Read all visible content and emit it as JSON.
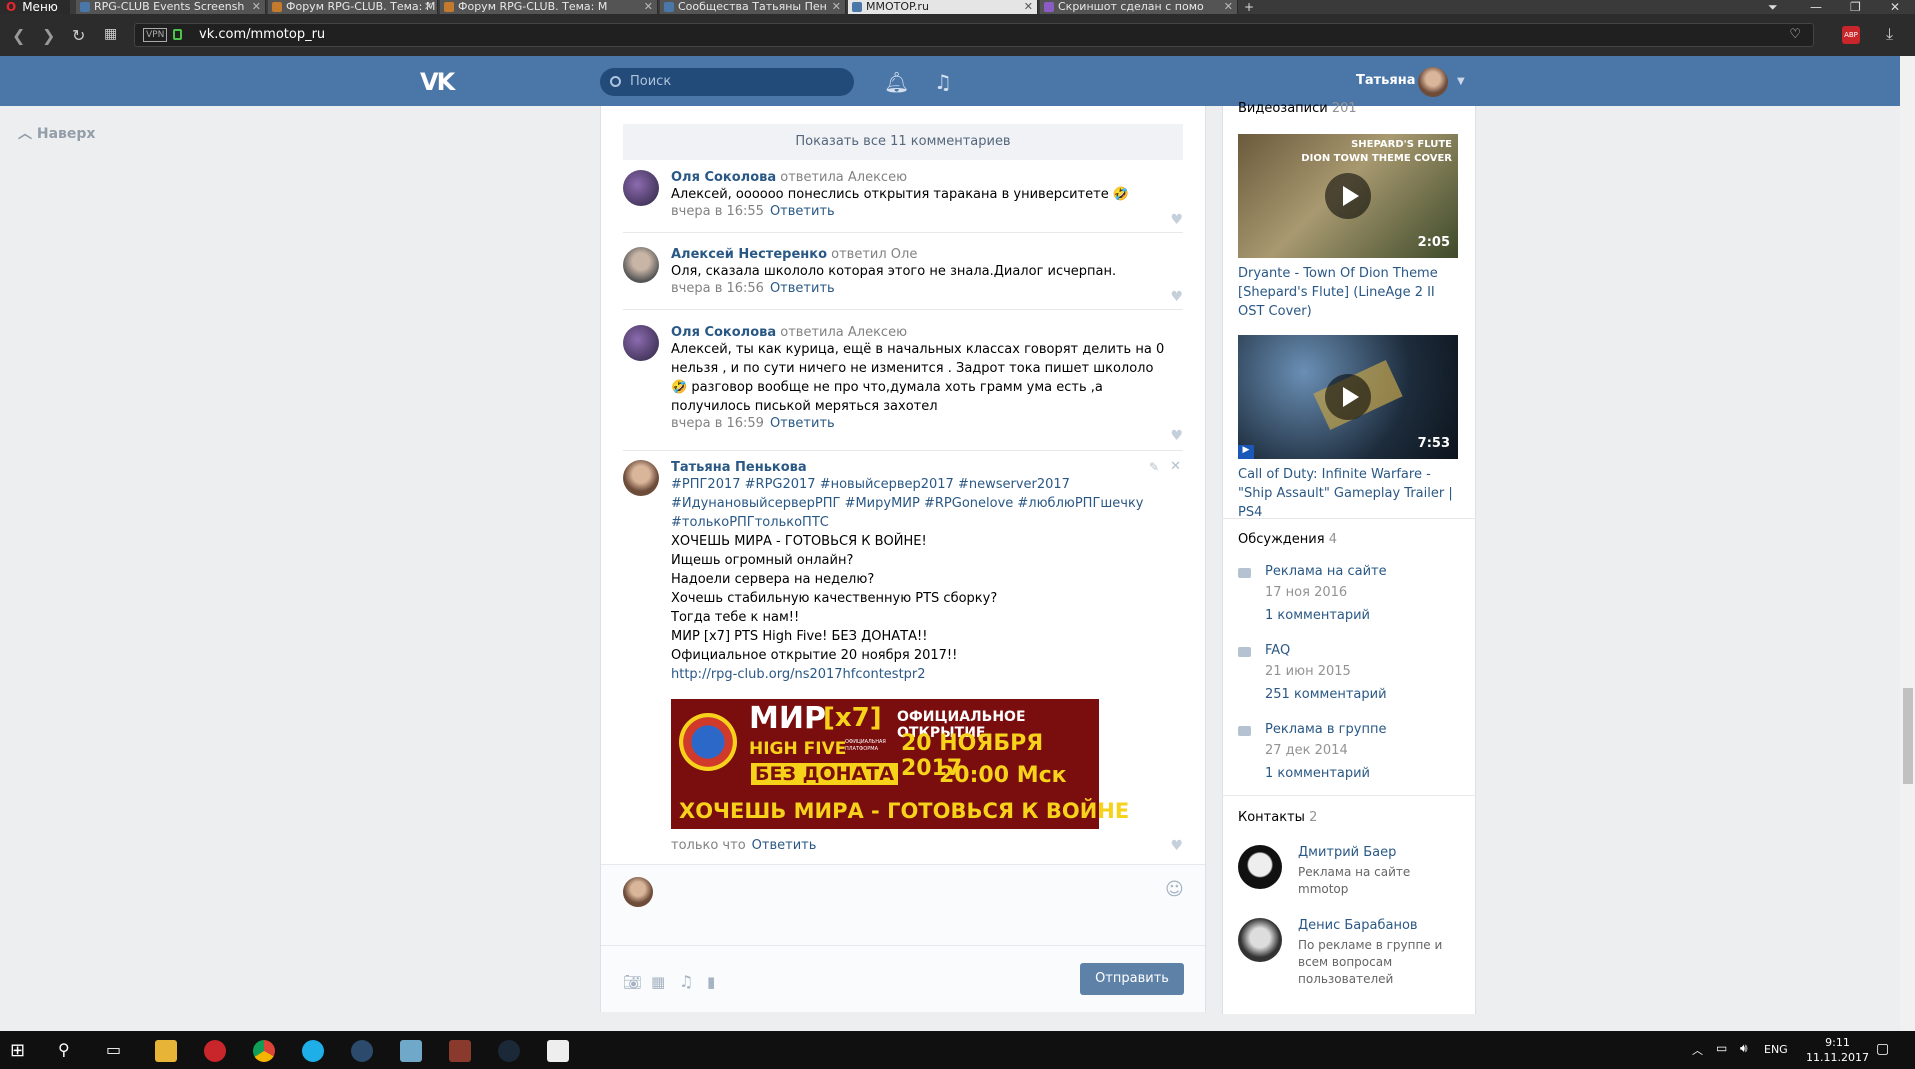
{
  "browser": {
    "menu_label": "Меню",
    "tabs": [
      {
        "title": "RPG-CLUB Events Screensh"
      },
      {
        "title": "Форум RPG-CLUB. Тема: М"
      },
      {
        "title": "Форум RPG-CLUB. Тема: М"
      },
      {
        "title": "Сообщества Татьяны Пен"
      },
      {
        "title": "MMOTOP.ru"
      },
      {
        "title": "Скриншот сделан с помо"
      }
    ],
    "new_tab": "+",
    "url": "vk.com/mmotop_ru",
    "vpn_label": "VPN",
    "abp_label": "ABP"
  },
  "vk_header": {
    "logo": "VK",
    "search_placeholder": "Поиск",
    "user_name": "Татьяна"
  },
  "left_nav": {
    "up_label": "Наверх"
  },
  "wall": {
    "show_all": "Показать все 11 комментариев",
    "comments": [
      {
        "author": "Оля Соколова",
        "reply_to": "ответила Алексею",
        "text": "Алексей, оооооо понеслись открытия таракана в университете 🤣",
        "date": "вчера в 16:55",
        "answer": "Ответить"
      },
      {
        "author": "Алексей Нестеренко",
        "reply_to": "ответил Оле",
        "text": "Оля, сказала школоло которая этого не знала.Диалог исчерпан.",
        "date": "вчера в 16:56",
        "answer": "Ответить"
      },
      {
        "author": "Оля Соколова",
        "reply_to": "ответила Алексею",
        "text": "Алексей, ты как курица, ещё в начальных классах говорят делить на 0 нельзя , и по сути ничего не изменится . Задрот тока пишет школоло🤣 разговор вообще не про что,думала хоть грамм ума есть ,а получилось писькой меряться захотел",
        "date": "вчера в 16:59",
        "answer": "Ответить"
      }
    ],
    "post": {
      "author": "Татьяна Пенькова",
      "hashtags_line1": "#РПГ2017 #RPG2017 #новыйсервер2017 #newserver2017",
      "hashtags_line2": "#ИдунановыйсерверРПГ #МируМИР #RPGonelove #люблюРПГшечку",
      "hashtags_line3": "#толькоРПГтолькоПТС",
      "lines": [
        "ХОЧЕШЬ МИРА - ГОТОВЬСЯ К ВОЙНЕ!",
        "Ищешь огромный онлайн?",
        "Надоели сервера на неделю?",
        "Хочешь стабильную качественную PTS сборку?",
        "Тогда тебе к нам!!",
        "МИР [x7] PTS High Five! БЕЗ ДОНАТА!!",
        "Официальное открытие 20 ноября 2017!!"
      ],
      "link": "http://rpg-club.org/ns2017hfcontestpr2",
      "banner": {
        "mir": "МИР",
        "x7": "[x7]",
        "high_five": "HIGH FIVE",
        "platform": "ОФИЦИАЛЬНАЯ ПЛАТФОРМА",
        "no_donate": "БЕЗ ДОНАТА",
        "official": "ОФИЦИАЛЬНОЕ ОТКРЫТИЕ",
        "date": "20 НОЯБРЯ 2017",
        "time": "20:00 Мск",
        "slogan": "ХОЧЕШЬ МИРА - ГОТОВЬСЯ К ВОЙНЕ"
      },
      "date": "только что",
      "answer": "Ответить"
    },
    "send_label": "Отправить"
  },
  "sidebar": {
    "videos": {
      "title": "Видеозаписи",
      "count": "201",
      "items": [
        {
          "overlay": "SHEPARD'S FLUTE",
          "overlay2": "DION TOWN THEME COVER",
          "duration": "2:05",
          "title": "Dryante - Town Of Dion Theme [Shepard's Flute] (LineAge 2 II OST Cover)"
        },
        {
          "duration": "7:53",
          "title": "Call of Duty: Infinite Warfare - \"Ship Assault\" Gameplay Trailer | PS4"
        }
      ]
    },
    "discussions": {
      "title": "Обсуждения",
      "count": "4",
      "items": [
        {
          "title": "Реклама на сайте",
          "date": "17 ноя 2016",
          "comments": "1 комментарий"
        },
        {
          "title": "FAQ",
          "date": "21 июн 2015",
          "comments": "251 комментарий"
        },
        {
          "title": "Реклама в группе",
          "date": "27 дек 2014",
          "comments": "1 комментарий"
        }
      ]
    },
    "contacts": {
      "title": "Контакты",
      "count": "2",
      "items": [
        {
          "name": "Дмитрий Баер",
          "desc": "Реклама на сайте mmotop"
        },
        {
          "name": "Денис Барабанов",
          "desc": "По рекламе в группе и всем вопросам пользователей"
        }
      ]
    }
  },
  "taskbar": {
    "lang": "ENG",
    "time": "9:11",
    "date": "11.11.2017"
  },
  "colors": {
    "vk_blue": "#4a76a8",
    "link": "#2a5885",
    "banner_red": "#7a0d0d",
    "banner_yellow": "#f7d21a"
  }
}
